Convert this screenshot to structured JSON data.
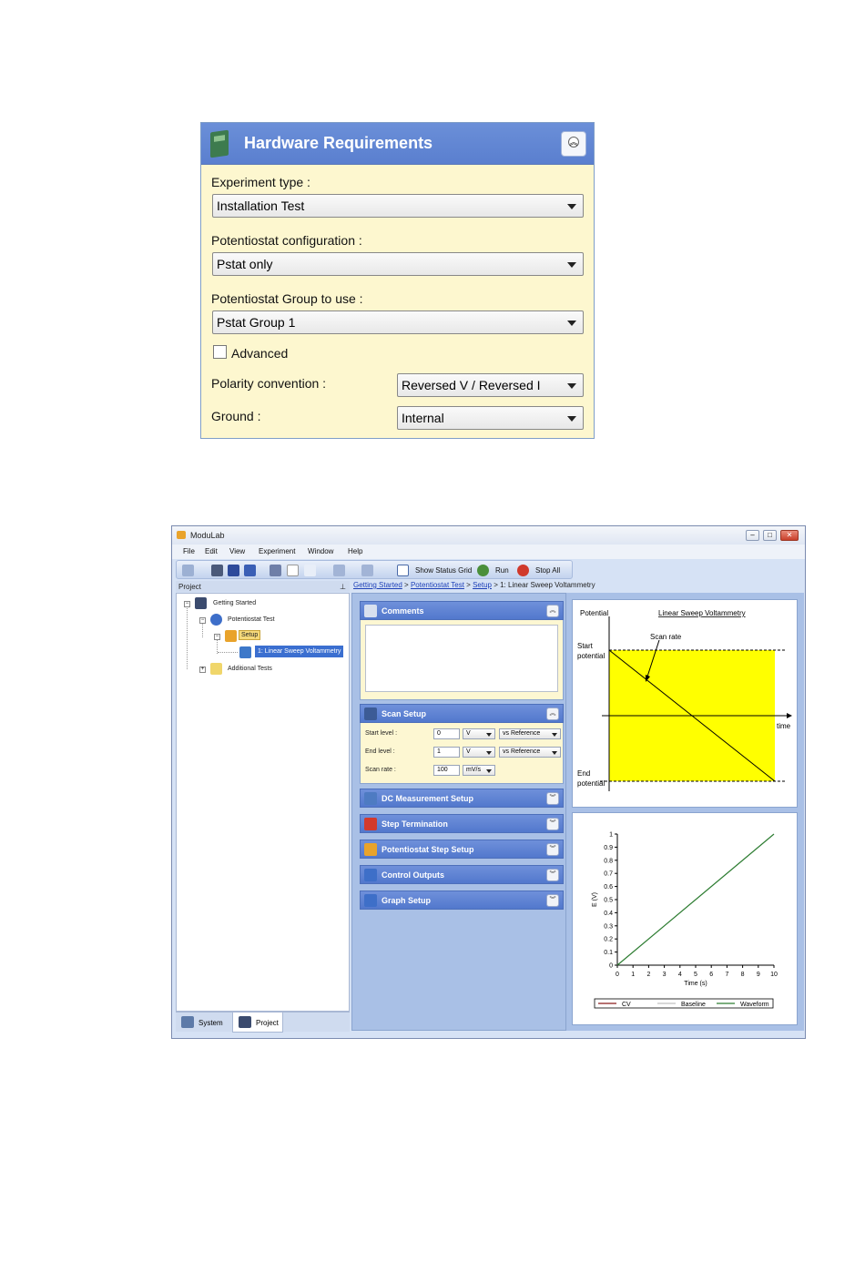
{
  "hardware": {
    "title": "Hardware Requirements",
    "experiment_type_label": "Experiment type :",
    "experiment_type_value": "Installation Test",
    "pstat_config_label": "Potentiostat configuration :",
    "pstat_config_value": "Pstat only",
    "pstat_group_label": "Potentiostat Group to use :",
    "pstat_group_value": "Pstat Group 1",
    "advanced_label": "Advanced",
    "polarity_label": "Polarity convention :",
    "polarity_value": "Reversed V / Reversed I",
    "ground_label": "Ground :",
    "ground_value": "Internal"
  },
  "window": {
    "title": "ModuLab",
    "menu": [
      "File",
      "Edit",
      "View",
      "Experiment",
      "Window",
      "Help"
    ],
    "toolbar": {
      "status_grid": "Show Status Grid",
      "run": "Run",
      "stop_all": "Stop All"
    },
    "project_header": "Project",
    "tree": {
      "getting_started": "Getting Started",
      "potentiostat_test": "Potentiostat Test",
      "setup": "Setup",
      "lsv": "1: Linear Sweep Voltammetry",
      "additional": "Additional Tests"
    },
    "tabs": {
      "system": "System",
      "project": "Project"
    },
    "breadcrumb": {
      "c1": "Getting Started",
      "sep": " > ",
      "c2": "Potentiostat Test",
      "c3": "Setup",
      "c4": "1: Linear Sweep Voltammetry"
    },
    "sections": {
      "comments": "Comments",
      "scan_setup": "Scan Setup",
      "dc": "DC Measurement Setup",
      "step_term": "Step Termination",
      "pstat_step": "Potentiostat Step Setup",
      "control_outputs": "Control Outputs",
      "graph_setup": "Graph Setup"
    },
    "scan": {
      "start_label": "Start level :",
      "start_value": "0",
      "start_unit": "V",
      "start_ref": "vs Reference",
      "end_label": "End level :",
      "end_value": "1",
      "end_unit": "V",
      "end_ref": "vs Reference",
      "rate_label": "Scan rate :",
      "rate_value": "100",
      "rate_unit": "mV/s"
    },
    "diagram": {
      "title": "Linear Sweep Voltammetry",
      "potential": "Potential",
      "scan_rate": "Scan rate",
      "start1": "Start",
      "start2": "potential",
      "end1": "End",
      "end2": "potential",
      "time": "time"
    }
  },
  "chart_data": {
    "type": "line",
    "xlabel": "Time (s)",
    "ylabel": "E (V)",
    "xlim": [
      0,
      10
    ],
    "ylim": [
      0,
      1
    ],
    "xticks": [
      "0",
      "1",
      "2",
      "3",
      "4",
      "5",
      "6",
      "7",
      "8",
      "9",
      "10"
    ],
    "yticks": [
      "0",
      "0.1",
      "0.2",
      "0.3",
      "0.4",
      "0.5",
      "0.6",
      "0.7",
      "0.8",
      "0.9",
      "1"
    ],
    "series": [
      {
        "name": "CV",
        "color": "#8b1c1c",
        "x": [],
        "y": []
      },
      {
        "name": "Baseline",
        "color": "#c0c0c0",
        "x": [],
        "y": []
      },
      {
        "name": "Waveform",
        "color": "#2e7d32",
        "x": [
          0,
          10
        ],
        "y": [
          0,
          1
        ]
      }
    ],
    "legend": "bottom"
  }
}
